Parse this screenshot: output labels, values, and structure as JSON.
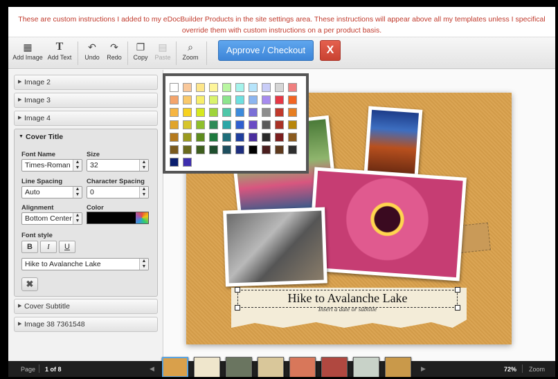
{
  "instructions": {
    "line1": "These are custom instructions I added to my eDocBuilder Products in the site settings area. These instructions will appear above all my templates unless I specifical",
    "line2": "override them with custom instructions on a per product basis."
  },
  "toolbar": {
    "add_image": "Add Image",
    "add_text": "Add Text",
    "undo": "Undo",
    "redo": "Redo",
    "copy": "Copy",
    "paste": "Paste",
    "zoom": "Zoom",
    "approve": "Approve / Checkout",
    "close": "X"
  },
  "panels": {
    "image2": "Image 2",
    "image3": "Image 3",
    "image4": "Image 4",
    "cover_title": "Cover Title",
    "cover_subtitle": "Cover Subtitle",
    "image38": "Image 38 7361548"
  },
  "cover_title_form": {
    "font_name_label": "Font Name",
    "font_name_value": "Times-Roman",
    "size_label": "Size",
    "size_value": "32",
    "line_spacing_label": "Line Spacing",
    "line_spacing_value": "Auto",
    "char_spacing_label": "Character Spacing",
    "char_spacing_value": "0",
    "alignment_label": "Alignment",
    "alignment_value": "Bottom Center",
    "color_label": "Color",
    "color_value": "#000000",
    "font_style_label": "Font style",
    "bold": "B",
    "italic": "I",
    "underline": "U",
    "text_value": "Hike to Avalanche Lake"
  },
  "canvas": {
    "title": "Hike to Avalanche Lake",
    "subtitle": "Insert a date or subtitle"
  },
  "palette": [
    [
      "#ffffff",
      "#f9c89b",
      "#fde68a",
      "#fdf59a",
      "#b9f6a1",
      "#a5f3ec",
      "#b6e4fb",
      "#c9cdf8",
      "#d6d6d6",
      "#f08080"
    ],
    [
      "#f4a46b",
      "#f9c96b",
      "#f7ee6b",
      "#d9f36b",
      "#8de58d",
      "#6ee0e0",
      "#8cb5f0",
      "#a78bef",
      "#e63946",
      "#f26522"
    ],
    [
      "#f6b541",
      "#f7d21f",
      "#d6e81f",
      "#9fd43a",
      "#4fc7a9",
      "#3d8bdb",
      "#7a6fd6",
      "#8e8e8e",
      "#c0392b",
      "#e67e22"
    ],
    [
      "#e0a42b",
      "#d6c52b",
      "#8fbf2b",
      "#2e8b57",
      "#2aa6a6",
      "#2f5fcf",
      "#6a4bc4",
      "#5a5a5a",
      "#a93226",
      "#b8860b"
    ],
    [
      "#b57a1e",
      "#9a9a1e",
      "#5e8c1e",
      "#1e7a3e",
      "#1e6e7a",
      "#1e3e9e",
      "#4a2e9e",
      "#2a2a2a",
      "#7b1e1e",
      "#8a5a1e"
    ],
    [
      "#7a5a1e",
      "#6a6a1e",
      "#3e5e1e",
      "#1e4e2e",
      "#1e4e5e",
      "#1e2e7e",
      "#000000",
      "#4a1e1e",
      "#5e3a1e",
      "#2e2e2e"
    ],
    [
      "#0a1e6e",
      "#3e2eae"
    ]
  ],
  "bottom": {
    "page_label": "Page",
    "page_value": "1 of 8",
    "zoom_value": "72%",
    "zoom_label": "Zoom",
    "prev": "◀",
    "next": "▶"
  },
  "thumbnail_colors": [
    "#d9a04b",
    "#efe6cc",
    "#6a7560",
    "#d9c79a",
    "#d8775a",
    "#b04840",
    "#c8d2c8",
    "#c9994a"
  ]
}
